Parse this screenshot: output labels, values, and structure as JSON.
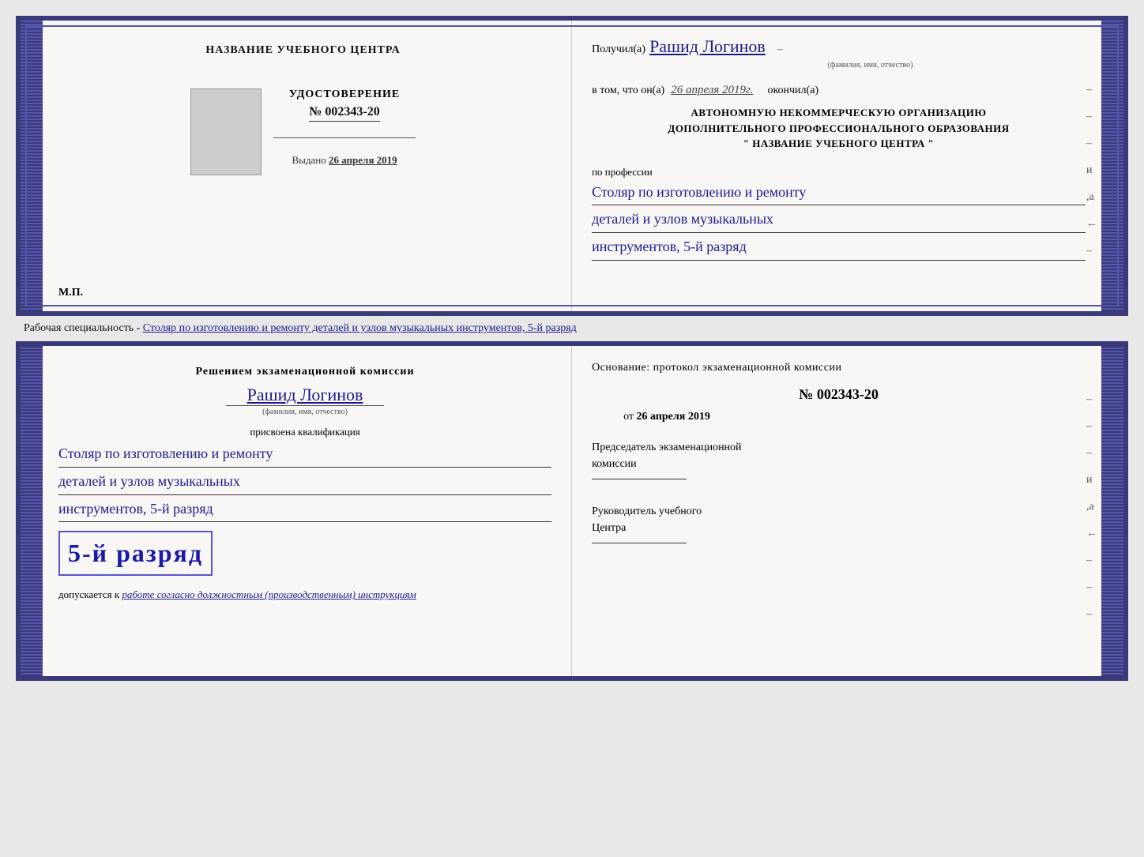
{
  "page": {
    "background": "#e8e8e8"
  },
  "top_cert": {
    "left": {
      "org_name": "НАЗВАНИЕ УЧЕБНОГО ЦЕНТРА",
      "udostoverenie_label": "УДОСТОВЕРЕНИЕ",
      "number_prefix": "№",
      "number": "002343-20",
      "issued_prefix": "Выдано",
      "issued_date": "26 апреля 2019",
      "mp_label": "М.П."
    },
    "right": {
      "received_prefix": "Получил(а)",
      "recipient_name": "Рашид Логинов",
      "name_subtitle": "(фамилия, имя, отчество)",
      "in_that_prefix": "в том, что он(а)",
      "date_handwritten": "26 апреля 2019г.",
      "okoncil": "окончил(а)",
      "org_line1": "АВТОНОМНУЮ НЕКОММЕРЧЕСКУЮ ОРГАНИЗАЦИЮ",
      "org_line2": "ДОПОЛНИТЕЛЬНОГО ПРОФЕССИОНАЛЬНОГО ОБРАЗОВАНИЯ",
      "org_name_quoted": "\"  НАЗВАНИЕ УЧЕБНОГО ЦЕНТРА  \"",
      "po_professii": "по профессии",
      "profession_line1": "Столяр по изготовлению и ремонту",
      "profession_line2": "деталей и узлов музыкальных",
      "profession_line3": "инструментов, 5-й разряд",
      "dashes": [
        "-",
        "-",
        "-",
        "и",
        ",а",
        "←",
        "-"
      ]
    }
  },
  "between_text": "Рабочая специальность - Столяр по изготовлению и ремонту деталей и узлов музыкальных инструментов, 5-й разряд",
  "bottom_cert": {
    "left": {
      "resheniyem": "Решением экзаменационной комиссии",
      "recipient_name": "Рашид Логинов",
      "name_subtitle": "(фамилия, имя, отчество)",
      "prisvoena": "присвоена квалификация",
      "qual_line1": "Столяр по изготовлению и ремонту",
      "qual_line2": "деталей и узлов музыкальных",
      "qual_line3": "инструментов, 5-й разряд",
      "highlight_text": "5-й разряд",
      "dopuskaetsya_prefix": "допускается к",
      "dopuskaetsya_italic": "работе согласно должностным (производственным) инструкциям"
    },
    "right": {
      "osnovaniye": "Основание: протокол экзаменационной комиссии",
      "number_prefix": "№",
      "number": "002343-20",
      "ot_prefix": "от",
      "ot_date": "26 апреля 2019",
      "predsedatel_line1": "Председатель экзаменационной",
      "predsedatel_line2": "комиссии",
      "rukovoditel_line1": "Руководитель учебного",
      "rukovoditel_line2": "Центра",
      "dashes": [
        "-",
        "-",
        "-",
        "и",
        ",а",
        "←",
        "-",
        "-",
        "-"
      ]
    }
  }
}
